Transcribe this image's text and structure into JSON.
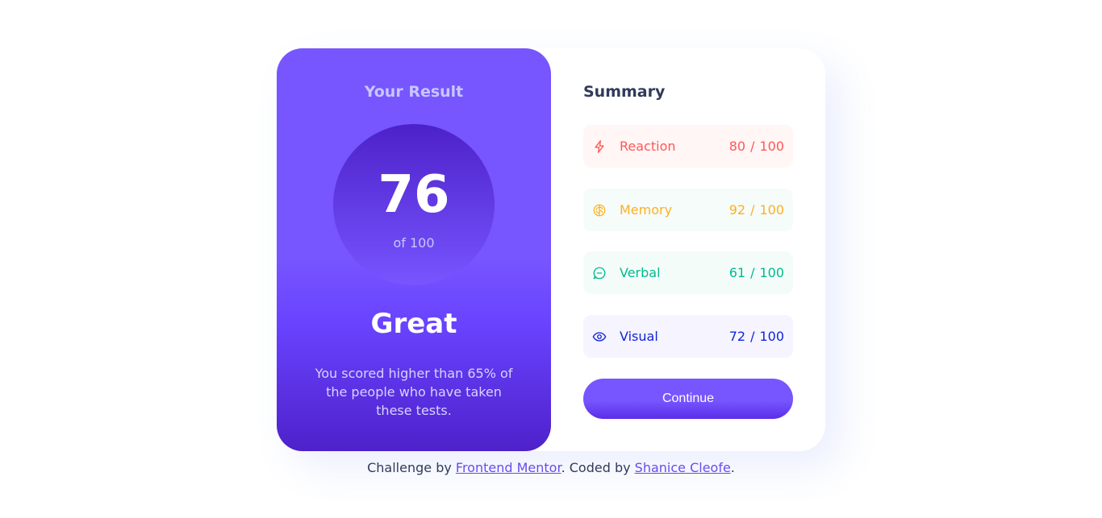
{
  "result": {
    "title": "Your Result",
    "score": "76",
    "score_of": "of 100",
    "grade": "Great",
    "description": "You scored higher than 65% of the people who have taken these tests."
  },
  "summary": {
    "title": "Summary",
    "items": [
      {
        "label": "Reaction",
        "score": "80",
        "max": "100",
        "icon": "lightning-icon",
        "color": "#ff5757",
        "bg": "#fff6f5"
      },
      {
        "label": "Memory",
        "score": "92",
        "max": "100",
        "icon": "brain-icon",
        "color": "#ffb01f",
        "bg": "#f5fcfa"
      },
      {
        "label": "Verbal",
        "score": "61",
        "max": "100",
        "icon": "chat-bubble-icon",
        "color": "#00bb8f",
        "bg": "#f4fcf9"
      },
      {
        "label": "Visual",
        "score": "72",
        "max": "100",
        "icon": "eye-icon",
        "color": "#1125d6",
        "bg": "#f5f4ff"
      }
    ],
    "continue_label": "Continue"
  },
  "attribution": {
    "prefix": "Challenge by ",
    "link1": "Frontend Mentor",
    "middle": ". Coded by ",
    "link2": "Shanice Cleofe",
    "suffix": "."
  },
  "colors": {
    "accent": "#7755ff",
    "accent_dark": "#4e21ca",
    "text_dark": "#303b5a"
  }
}
